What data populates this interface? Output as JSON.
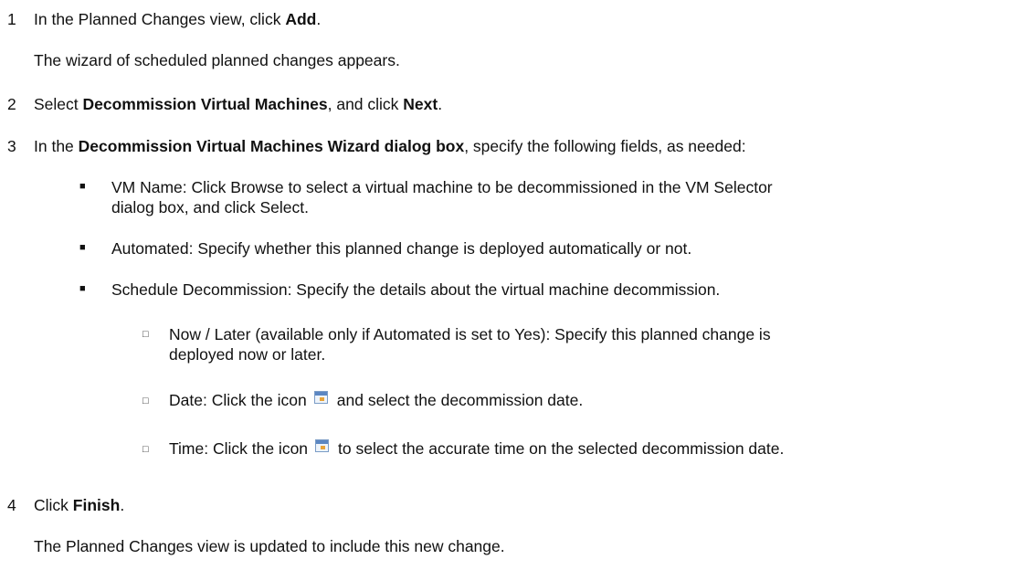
{
  "steps": [
    {
      "number": "1",
      "pre": "In the Planned Changes view, click ",
      "bold": "Add",
      "post": ".",
      "note": "The wizard of scheduled planned changes appears."
    },
    {
      "number": "2",
      "pre": "Select ",
      "bold1": "Decommission Virtual Machines",
      "mid": ", and click ",
      "bold2": "Next",
      "post": "."
    },
    {
      "number": "3",
      "pre": "In the ",
      "bold": "Decommission Virtual Machines Wizard dialog box",
      "post": ", specify the following fields, as needed:",
      "bullets": [
        {
          "text_line1": "VM Name: Click Browse to select a virtual machine to be decommissioned in the VM Selector",
          "text_line2": "dialog box, and click Select."
        },
        {
          "text": "Automated: Specify whether this planned change is deployed automatically or not."
        },
        {
          "text": "Schedule Decommission: Specify the details about the virtual machine decommission."
        }
      ],
      "subbullets": [
        {
          "text_line1": "Now / Later (available only if Automated is set to Yes): Specify this planned change is",
          "text_line2": "deployed now or later."
        },
        {
          "pre": "Date: Click the icon",
          "post": "and select the decommission date."
        },
        {
          "pre": "Time: Click the icon",
          "post": "to select the accurate time on the selected decommission date."
        }
      ]
    },
    {
      "number": "4",
      "pre": "Click ",
      "bold": "Finish",
      "post": ".",
      "note": "The Planned Changes view is updated to include this new change."
    }
  ],
  "bullet_glyph": "■",
  "subbullet_glyph": "□",
  "icons": {
    "calendar": "calendar-icon"
  }
}
